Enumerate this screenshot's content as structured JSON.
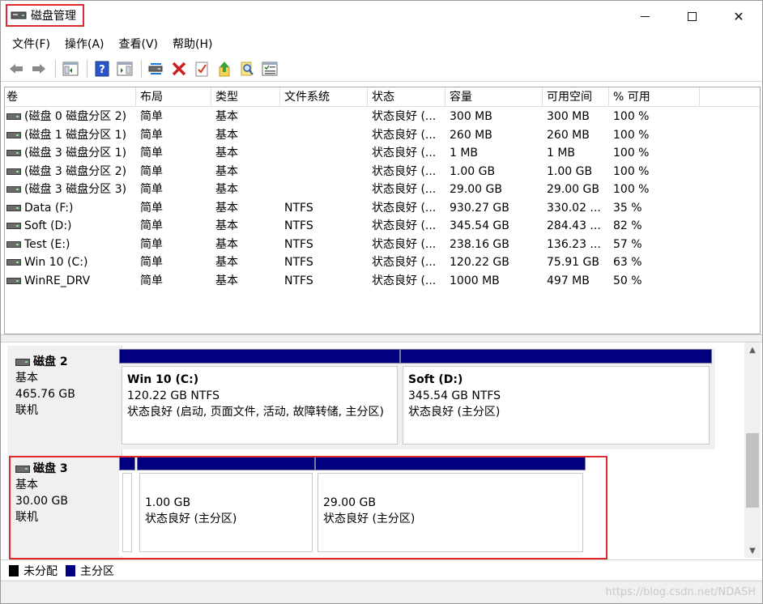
{
  "window": {
    "title": "磁盘管理",
    "minimize_label": "",
    "maximize_label": "",
    "close_label": "✕"
  },
  "menu": [
    "文件(F)",
    "操作(A)",
    "查看(V)",
    "帮助(H)"
  ],
  "toolbar": [
    {
      "icon": "back-arrow-icon"
    },
    {
      "icon": "forward-arrow-icon"
    },
    {
      "icon": "show-hide-console-tree-icon"
    },
    {
      "icon": "help-icon"
    },
    {
      "icon": "show-action-pane-icon"
    },
    {
      "icon": "connect-virtual-disk-icon"
    },
    {
      "icon": "delete-icon"
    },
    {
      "icon": "check-icon"
    },
    {
      "icon": "up-folder-icon"
    },
    {
      "icon": "search-icon"
    },
    {
      "icon": "properties-icon"
    }
  ],
  "volume_list": {
    "columns": [
      "卷",
      "布局",
      "类型",
      "文件系统",
      "状态",
      "容量",
      "可用空间",
      "% 可用"
    ],
    "rows": [
      [
        "(磁盘 0 磁盘分区 2)",
        "简单",
        "基本",
        "",
        "状态良好 (...",
        "300 MB",
        "300 MB",
        "100 %"
      ],
      [
        "(磁盘 1 磁盘分区 1)",
        "简单",
        "基本",
        "",
        "状态良好 (...",
        "260 MB",
        "260 MB",
        "100 %"
      ],
      [
        "(磁盘 3 磁盘分区 1)",
        "简单",
        "基本",
        "",
        "状态良好 (...",
        "1 MB",
        "1 MB",
        "100 %"
      ],
      [
        "(磁盘 3 磁盘分区 2)",
        "简单",
        "基本",
        "",
        "状态良好 (...",
        "1.00 GB",
        "1.00 GB",
        "100 %"
      ],
      [
        "(磁盘 3 磁盘分区 3)",
        "简单",
        "基本",
        "",
        "状态良好 (...",
        "29.00 GB",
        "29.00 GB",
        "100 %"
      ],
      [
        "Data (F:)",
        "简单",
        "基本",
        "NTFS",
        "状态良好 (...",
        "930.27 GB",
        "330.02 ...",
        "35 %"
      ],
      [
        "Soft (D:)",
        "简单",
        "基本",
        "NTFS",
        "状态良好 (...",
        "345.54 GB",
        "284.43 ...",
        "82 %"
      ],
      [
        "Test (E:)",
        "简单",
        "基本",
        "NTFS",
        "状态良好 (...",
        "238.16 GB",
        "136.23 ...",
        "57 %"
      ],
      [
        "Win 10 (C:)",
        "简单",
        "基本",
        "NTFS",
        "状态良好 (...",
        "120.22 GB",
        "75.91 GB",
        "63 %"
      ],
      [
        "WinRE_DRV",
        "简单",
        "基本",
        "NTFS",
        "状态良好 (...",
        "1000 MB",
        "497 MB",
        "50 %"
      ]
    ]
  },
  "disks": {
    "disk2": {
      "name": "磁盘 2",
      "type": "基本",
      "size": "465.76 GB",
      "status": "联机",
      "partitions": [
        {
          "name": "Win 10  (C:)",
          "size": "120.22 GB NTFS",
          "status": "状态良好 (启动, 页面文件, 活动, 故障转储, 主分区)"
        },
        {
          "name": "Soft  (D:)",
          "size": "345.54 GB NTFS",
          "status": "状态良好 (主分区)"
        }
      ]
    },
    "disk3": {
      "name": "磁盘 3",
      "type": "基本",
      "size": "30.00 GB",
      "status": "联机",
      "partitions": [
        {
          "name": "",
          "size": "",
          "status": ""
        },
        {
          "name": "",
          "size": "1.00 GB",
          "status": "状态良好 (主分区)"
        },
        {
          "name": "",
          "size": "29.00 GB",
          "status": "状态良好 (主分区)"
        }
      ]
    }
  },
  "legend": [
    {
      "label": "未分配",
      "color": "#000000"
    },
    {
      "label": "主分区",
      "color": "#000080"
    }
  ],
  "watermark": "https://blog.csdn.net/NDASH",
  "colors": {
    "primary_partition": "#000080",
    "highlight": "#e0282e"
  }
}
